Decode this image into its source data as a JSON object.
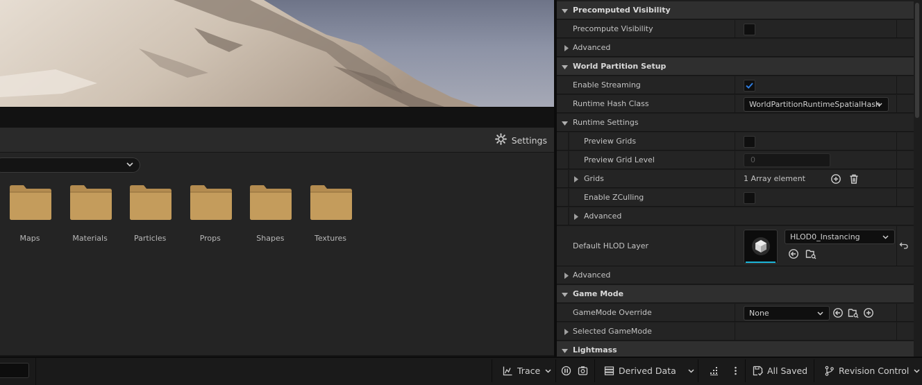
{
  "content_browser": {
    "settings_label": "Settings",
    "folders": [
      {
        "label": "Maps"
      },
      {
        "label": "Materials"
      },
      {
        "label": "Particles"
      },
      {
        "label": "Props"
      },
      {
        "label": "Shapes"
      },
      {
        "label": "Textures"
      }
    ]
  },
  "details": {
    "precomputed_visibility": {
      "header": "Precomputed Visibility",
      "precompute_visibility_label": "Precompute Visibility",
      "precompute_visibility_checked": false,
      "advanced_label": "Advanced"
    },
    "world_partition_setup": {
      "header": "World Partition Setup",
      "enable_streaming_label": "Enable Streaming",
      "enable_streaming_checked": true,
      "runtime_hash_class_label": "Runtime Hash Class",
      "runtime_hash_class_value": "WorldPartitionRuntimeSpatialHash",
      "runtime_settings": {
        "header": "Runtime Settings",
        "preview_grids_label": "Preview Grids",
        "preview_grids_checked": false,
        "preview_grid_level_label": "Preview Grid Level",
        "preview_grid_level_value": "0",
        "grids_label": "Grids",
        "grids_value": "1 Array element",
        "enable_zculling_label": "Enable ZCulling",
        "enable_zculling_checked": false,
        "advanced_label": "Advanced"
      },
      "default_hlod_layer_label": "Default HLOD Layer",
      "default_hlod_layer_value": "HLOD0_Instancing",
      "advanced_label": "Advanced"
    },
    "game_mode": {
      "header": "Game Mode",
      "gamemode_override_label": "GameMode Override",
      "gamemode_override_value": "None",
      "selected_gamemode_label": "Selected GameMode"
    },
    "lightmass": {
      "header": "Lightmass"
    }
  },
  "statusbar": {
    "trace_label": "Trace",
    "derived_data_label": "Derived Data",
    "all_saved_label": "All Saved",
    "revision_control_label": "Revision Control"
  },
  "colors": {
    "accent_check": "#2f7de1",
    "hlod_underline": "#1ab4d8",
    "folder": "#b48c50"
  }
}
